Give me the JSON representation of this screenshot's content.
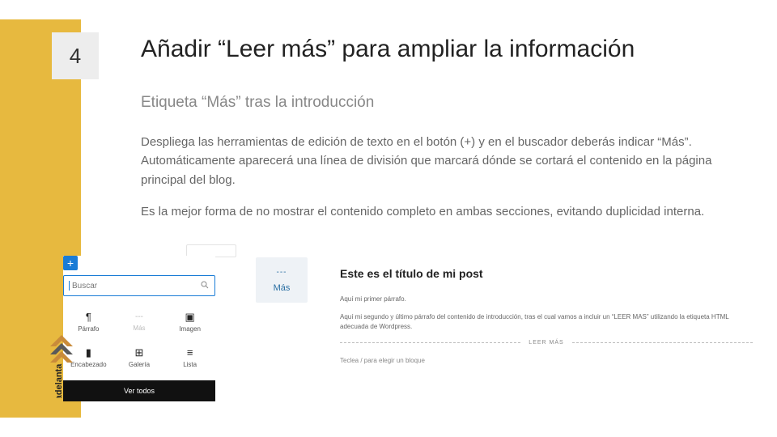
{
  "step": "4",
  "title": "Añadir “Leer más” para ampliar la información",
  "subtitle": "Etiqueta “Más” tras la introducción",
  "paragraph1": "Despliega las herramientas de edición de texto en el botón (+) y en el buscador deberás indicar “Más”. Automáticamente aparecerá una línea de división que marcará dónde se cortará el contenido en la página principal del blog.",
  "paragraph2": "Es la mejor forma de no mostrar el contenido completo en ambas secciones, evitando duplicidad interna.",
  "logo_text": "adelanta",
  "inserter": {
    "plus": "+",
    "search_placeholder": "Buscar",
    "blocks": [
      {
        "icon": "¶",
        "label": "Párrafo"
      },
      {
        "icon": "---",
        "label": "Más"
      },
      {
        "icon": "▣",
        "label": "Imagen"
      },
      {
        "icon": "▮",
        "label": "Encabezado"
      },
      {
        "icon": "⊞",
        "label": "Galería"
      },
      {
        "icon": "≡",
        "label": "Lista"
      }
    ],
    "see_all": "Ver todos"
  },
  "mas_block": {
    "icon": "---",
    "label": "Más"
  },
  "editor": {
    "post_title": "Este es el título de mi post",
    "p1": "Aquí mi primer párrafo.",
    "p2": "Aquí mi segundo y último párrafo del contenido de introducción, tras el cual vamos a incluir un “LEER MAS” utilizando la etiqueta HTML adecuada de Wordpress.",
    "more_label": "LEER MÁS",
    "prompt": "Teclea / para elegir un bloque"
  }
}
